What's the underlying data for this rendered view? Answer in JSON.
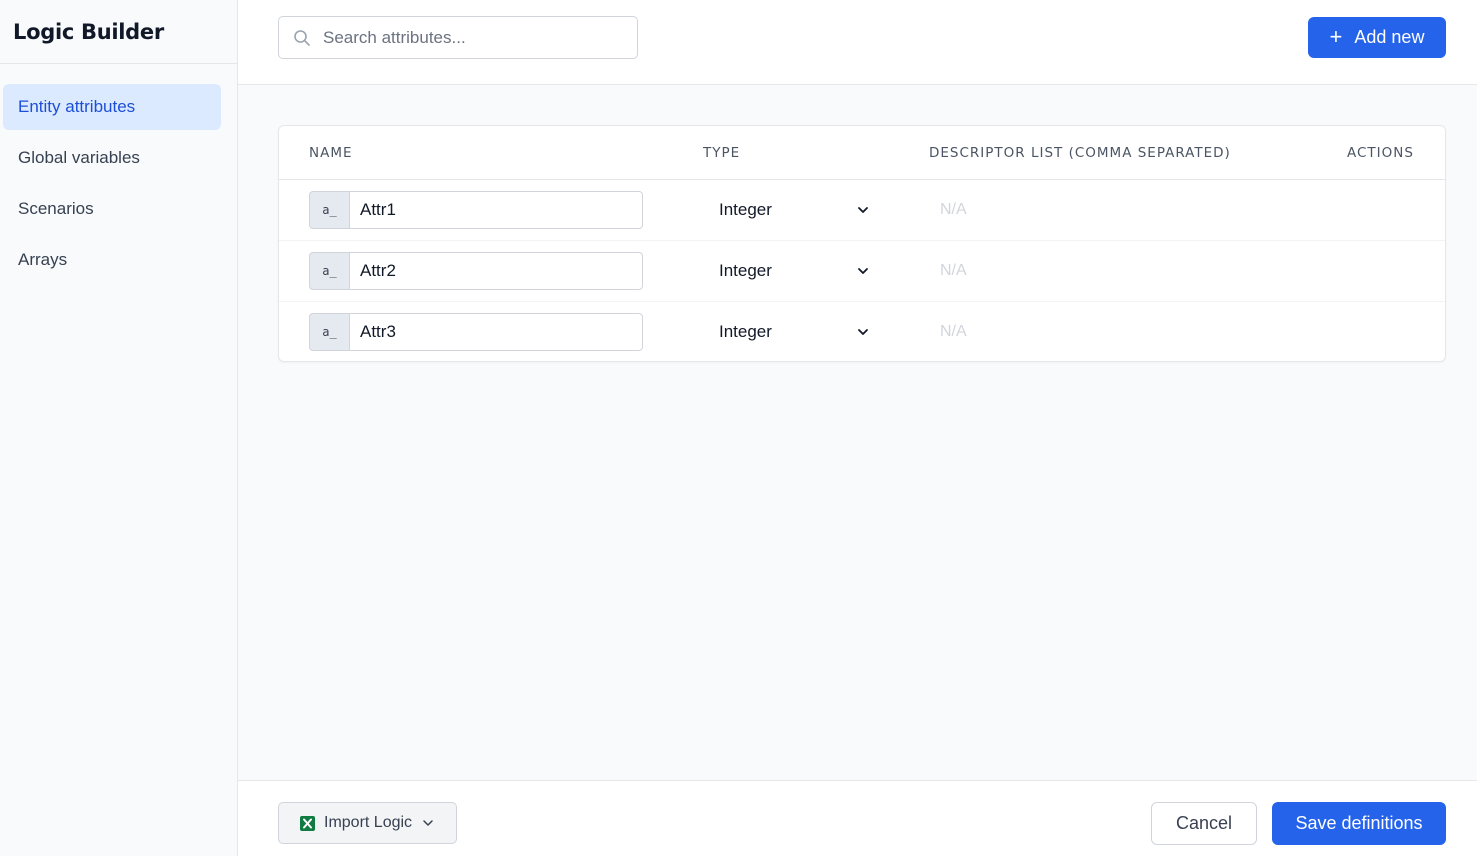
{
  "app": {
    "title": "Logic Builder"
  },
  "sidebar": {
    "items": [
      {
        "label": "Entity attributes",
        "active": true
      },
      {
        "label": "Global variables",
        "active": false
      },
      {
        "label": "Scenarios",
        "active": false
      },
      {
        "label": "Arrays",
        "active": false
      }
    ]
  },
  "toolbar": {
    "search_placeholder": "Search attributes...",
    "search_icon": "search-icon",
    "add_label": "Add new",
    "add_icon": "plus-icon"
  },
  "table": {
    "columns": [
      "NAME",
      "TYPE",
      "DESCRIPTOR LIST (COMMA SEPARATED)",
      "ACTIONS"
    ],
    "name_prefix": "a_",
    "rows": [
      {
        "name": "Attr1",
        "type": "Integer",
        "descriptor": "N/A"
      },
      {
        "name": "Attr2",
        "type": "Integer",
        "descriptor": "N/A"
      },
      {
        "name": "Attr3",
        "type": "Integer",
        "descriptor": "N/A"
      }
    ]
  },
  "footer": {
    "import_label": "Import Logic",
    "import_icon": "excel-icon",
    "cancel_label": "Cancel",
    "save_label": "Save definitions"
  },
  "colors": {
    "primary": "#2563eb",
    "active_nav_bg": "#dbeafe",
    "active_nav_text": "#1d4ed8",
    "excel_green": "#107c41"
  }
}
